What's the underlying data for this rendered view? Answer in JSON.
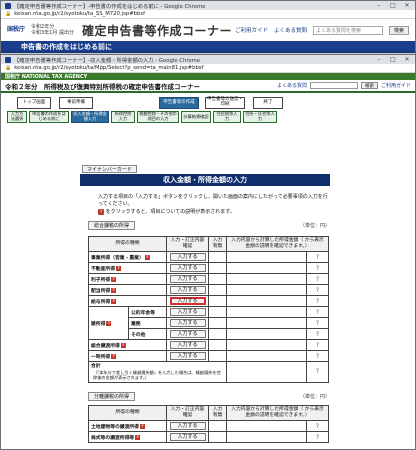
{
  "window1": {
    "title": "【確定申告書等作成コーナー】-申告書の作成をはじめる前に - Google Chrome",
    "url": "keisan.nta.go.jp/r2/syotoku/ta_SS_M720.jsp#bbsf",
    "logo": "国税庁",
    "year_line1": "令和2年分",
    "year_line2": "令和3年1月 提出分",
    "app_title": "確定申告書等作成コーナー",
    "links": [
      "ご利用ガイド",
      "よくある質問"
    ],
    "search_placeholder": "よくある質問を検索",
    "search_button": "検索",
    "band": "申告書の作成をはじめる前に"
  },
  "window2": {
    "title": "【確定申告書等作成コーナー】-収入金額・所得金額の入力 - Google Chrome",
    "url": "keisan.nta.go.jp/r2/syotoku/ta/Mpp/Select?p_send=ta_main81.jsp#bbsf",
    "agency": "国税庁 NATIONAL TAX AGENCY",
    "page_heading": "令和２年分　所得税及び復興特別所得税の確定申告書作成コーナー",
    "links": [
      "よくある質問",
      "ご利用ガイド"
    ],
    "search_button": "検索",
    "flow_steps": [
      "トップ画面",
      "事前準備",
      "申告書等の作成",
      "申告書等の送信・印刷",
      "終了"
    ],
    "flow_subs": [
      "入力方法選択",
      "申告書の作成をはじめる前に",
      "収入金額・所得金額入力",
      "所得控除入力",
      "税額控除・その他の項目の入力",
      "計算結果確認",
      "住民税等入力",
      "住所・氏名等入力"
    ],
    "mynumber_button": "マイナンバーカード",
    "band": "収入金額・所得金額の入力",
    "instructions": [
      "入力する項目の「入力する」ボタンをクリックし、開いた画面の案内にしたがって必要事項の入力を行ってください。",
      "をクリックすると、項目についての説明が表示されます。"
    ],
    "section1": "総合課税の所得",
    "section2": "分離課税の所得",
    "unit": "（単位：円）",
    "headers": {
      "kind": "所得の種類",
      "input": "入力・訂正内容確認",
      "status": "入力有無",
      "result": "入力内容から計算した所得金額（ から表示金額の説明を確認できます。）",
      "help_glyph": "?",
      "help_link": "?",
      "button": "入力する"
    },
    "rows1": [
      "事業所得（営業・農業）",
      "不動産所得",
      "利子所得",
      "配当所得",
      "給与所得",
      "雑所得",
      "公的年金等",
      "業務",
      "その他",
      "総合譲渡所得",
      "一時所得",
      "合計"
    ],
    "total_note": "（「本年分で差し引く繰越損失額」を入力した場合は、繰越損失を控除後の金額が表示されます。）",
    "rows2": [
      "土地建物等の譲渡所得",
      "株式等の譲渡所得等"
    ]
  }
}
